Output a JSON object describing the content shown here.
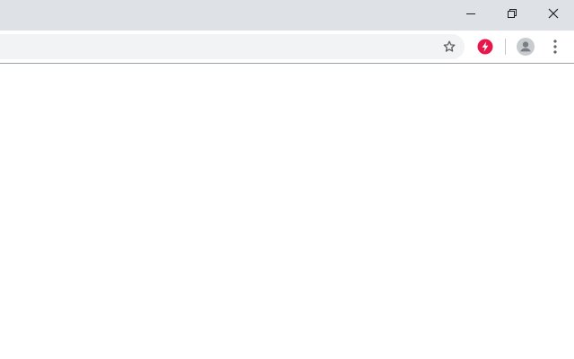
{
  "window": {
    "controls": {
      "minimize": "minimize-icon",
      "restore": "restore-icon",
      "close": "close-icon"
    }
  },
  "toolbar": {
    "address": {
      "value": "",
      "placeholder": ""
    },
    "bookmark_icon": "star-outline-icon",
    "extension": {
      "icon": "lightning-bolt-icon",
      "color": "#e8174b"
    },
    "profile_icon": "person-avatar-icon",
    "menu_icon": "kebab-menu-icon"
  },
  "colors": {
    "titlebar": "#dee1e6",
    "omnibox": "#f1f3f4",
    "icon": "#5f6368",
    "divider": "#c4c7ca"
  }
}
